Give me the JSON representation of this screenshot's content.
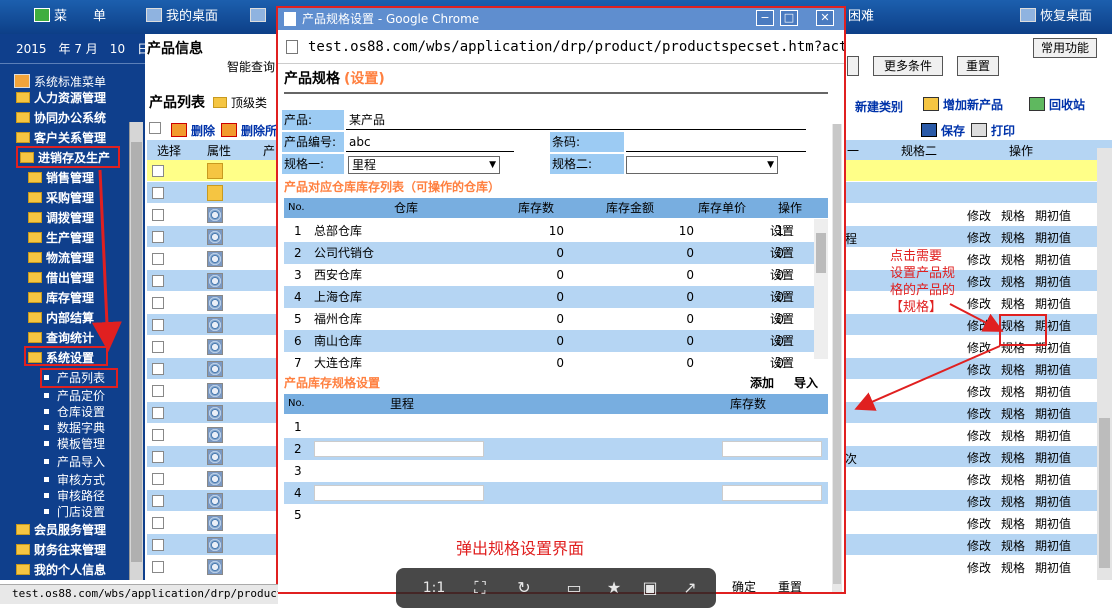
{
  "topbar": {
    "menu": "菜　　单",
    "desktop": "我的桌面",
    "partial": "困难",
    "restore": "恢复桌面"
  },
  "sidebar": {
    "date": "2015　年 7 月　10　日",
    "header": "系统标准菜单",
    "items": [
      {
        "label": "人力资源管理"
      },
      {
        "label": "协同办公系统"
      },
      {
        "label": "客户关系管理"
      },
      {
        "label": "进销存及生产"
      },
      {
        "label": "销售管理"
      },
      {
        "label": "采购管理"
      },
      {
        "label": "调拨管理"
      },
      {
        "label": "生产管理"
      },
      {
        "label": "物流管理"
      },
      {
        "label": "借出管理"
      },
      {
        "label": "库存管理"
      },
      {
        "label": "内部结算"
      },
      {
        "label": "查询统计"
      },
      {
        "label": "系统设置"
      },
      {
        "label": "产品列表"
      },
      {
        "label": "产品定价"
      },
      {
        "label": "仓库设置"
      },
      {
        "label": "数据字典"
      },
      {
        "label": "模板管理"
      },
      {
        "label": "产品导入"
      },
      {
        "label": "审核方式"
      },
      {
        "label": "审核路径"
      },
      {
        "label": "门店设置"
      },
      {
        "label": "会员服务管理"
      },
      {
        "label": "财务往来管理"
      },
      {
        "label": "我的个人信息"
      }
    ]
  },
  "main": {
    "title": "产品信息",
    "smart_query": "智能查询",
    "more_conditions": "更多条件",
    "reset": "重置",
    "common_functions": "常用功能",
    "list_title": "产品列表",
    "top_category": "顶级类",
    "new_category": "新建类别",
    "add_product": "增加新产品",
    "recycle": "回收站",
    "delete": "删除",
    "delete_all": "删除所",
    "save": "保存",
    "print": "打印",
    "col_select": "选择",
    "col_attr": "属性",
    "col_spec2": "规格二",
    "col_ops": "操作",
    "frag_cheng": "程",
    "frag_ci": "次",
    "row_actions": {
      "modify": "修改",
      "spec": "规格",
      "init": "期初值"
    }
  },
  "popup": {
    "window_title": "产品规格设置 - Google Chrome",
    "url": "test.os88.com/wbs/application/drp/product/productspecset.htm?action",
    "heading": "产品规格",
    "heading_link": "(设置)",
    "product_label": "产品:",
    "product_value": "某产品",
    "code_label": "产品编号:",
    "code_value": "abc",
    "barcode_label": "条码:",
    "spec1_label": "规格一:",
    "spec1_value": "里程",
    "spec2_label": "规格二:",
    "warehouse_section": "产品对应仓库库存列表（可操作的仓库）",
    "wh_headers": [
      "No.",
      "仓库",
      "库存数",
      "库存金额",
      "库存单价",
      "操作"
    ],
    "warehouses": [
      {
        "no": "1",
        "name": "总部仓库",
        "qty": "10",
        "amount": "10",
        "price": "1",
        "op": "设置"
      },
      {
        "no": "2",
        "name": "公司代销仓",
        "qty": "0",
        "amount": "0",
        "price": "0",
        "op": "设置"
      },
      {
        "no": "3",
        "name": "西安仓库",
        "qty": "0",
        "amount": "0",
        "price": "0",
        "op": "设置"
      },
      {
        "no": "4",
        "name": "上海仓库",
        "qty": "0",
        "amount": "0",
        "price": "0",
        "op": "设置"
      },
      {
        "no": "5",
        "name": "福州仓库",
        "qty": "0",
        "amount": "0",
        "price": "0",
        "op": "设置"
      },
      {
        "no": "6",
        "name": "南山仓库",
        "qty": "0",
        "amount": "0",
        "price": "0",
        "op": "设置"
      },
      {
        "no": "7",
        "name": "大连仓库",
        "qty": "0",
        "amount": "0",
        "price": "0",
        "op": "设置"
      }
    ],
    "spec_section": "产品库存规格设置",
    "add": "添加",
    "import": "导入",
    "spec_headers": [
      "No.",
      "里程",
      "库存数"
    ],
    "spec_rows": [
      "1",
      "2",
      "3",
      "4",
      "5"
    ],
    "confirm": "确定",
    "reset": "重置"
  },
  "annotations": {
    "click_hint": "点击需要\n设置产品规\n格的产品的\n【规格】",
    "popup_hint": "弹出规格设置界面"
  },
  "viewer": {
    "ratio": "1:1"
  },
  "statusbar": {
    "url": "test.os88.com/wbs/application/drp/product/pr"
  }
}
